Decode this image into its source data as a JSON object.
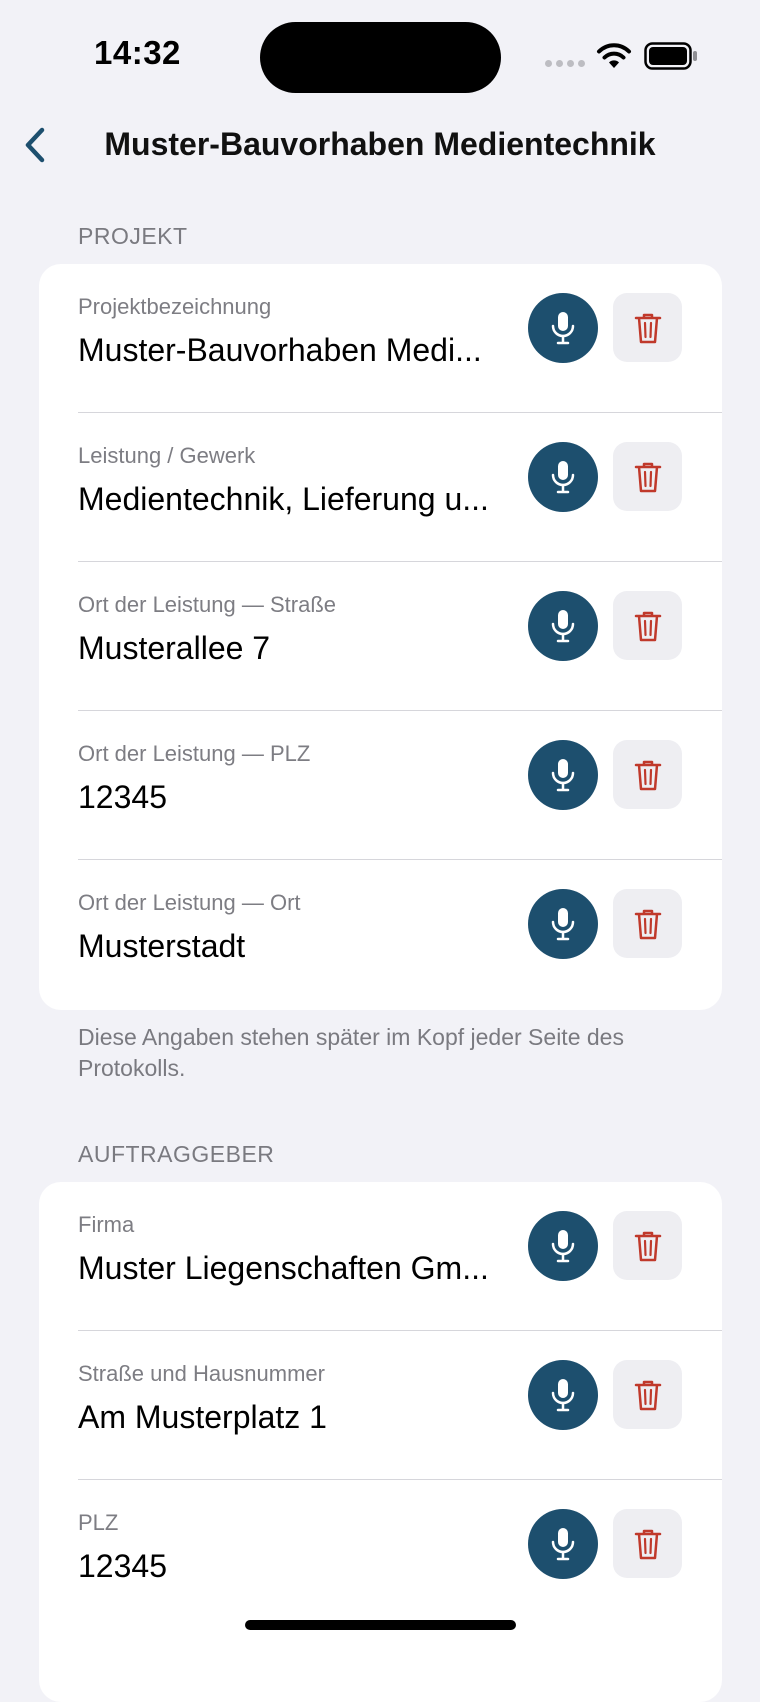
{
  "status_bar": {
    "time": "14:32"
  },
  "nav": {
    "title": "Muster-Bauvorhaben Medientechnik"
  },
  "project_section": {
    "header": "PROJEKT",
    "rows": [
      {
        "label": "Projektbezeichnung",
        "value": "Muster-Bauvorhaben Medi..."
      },
      {
        "label": "Leistung / Gewerk",
        "value": "Medientechnik, Lieferung u..."
      },
      {
        "label": "Ort der Leistung — Straße",
        "value": "Musterallee 7"
      },
      {
        "label": "Ort der Leistung — PLZ",
        "value": "12345"
      },
      {
        "label": "Ort der Leistung — Ort",
        "value": "Musterstadt"
      }
    ],
    "footer": "Diese Angaben stehen später im Kopf jeder Seite des Protokolls."
  },
  "client_section": {
    "header": "AUFTRAGGEBER",
    "rows": [
      {
        "label": "Firma",
        "value": "Muster Liegenschaften Gm..."
      },
      {
        "label": "Straße und Hausnummer",
        "value": "Am Musterplatz 1"
      },
      {
        "label": "PLZ",
        "value": "12345"
      }
    ]
  },
  "colors": {
    "background": "#F2F2F7",
    "accent": "#1D4F6E",
    "delete": "#C0392B",
    "secondary_text": "#7A7A80"
  },
  "icons": [
    "chevron-left-icon",
    "microphone-icon",
    "trash-icon",
    "wifi-icon",
    "battery-icon",
    "cellular-signal-icon"
  ]
}
